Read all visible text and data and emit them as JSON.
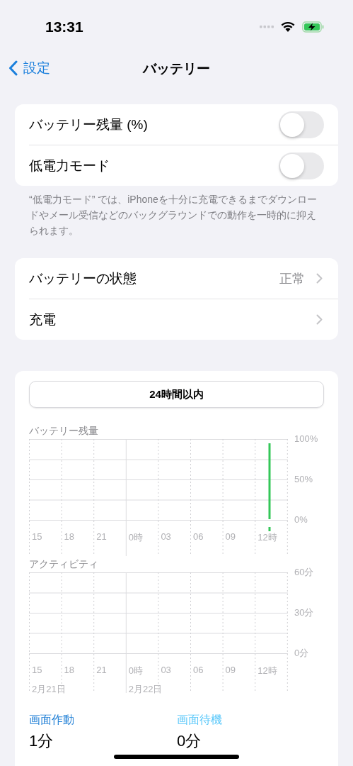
{
  "status_bar": {
    "time": "13:31"
  },
  "nav": {
    "back": "設定",
    "title": "バッテリー"
  },
  "toggles": [
    {
      "label": "バッテリー残量 (%)",
      "on": false
    },
    {
      "label": "低電力モード",
      "on": false
    }
  ],
  "footnote": "“低電力モード” では、iPhoneを十分に充電できるまでダウンロードやメール受信などのバックグラウンドでの動作を一時的に抑えられます。",
  "links": [
    {
      "label": "バッテリーの状態",
      "value": "正常"
    },
    {
      "label": "充電"
    }
  ],
  "usage": {
    "range_button": "24時間以内",
    "battery_chart": {
      "title": "バッテリー残量",
      "y_labels": [
        "100%",
        "50%",
        "0%"
      ],
      "x_labels": [
        "15",
        "18",
        "21",
        "0時",
        "03",
        "06",
        "09",
        "12時"
      ]
    },
    "activity_chart": {
      "title": "アクティビティ",
      "y_labels": [
        "60分",
        "30分",
        "0分"
      ],
      "x_labels": [
        "15",
        "18",
        "21",
        "0時",
        "03",
        "06",
        "09",
        "12時"
      ],
      "dates": [
        "2月21日",
        "2月22日"
      ]
    },
    "stats": [
      {
        "label": "画面作動",
        "value": "1分",
        "color": "#1f7fd6"
      },
      {
        "label": "画面待機",
        "value": "0分",
        "color": "#5ac8fa"
      }
    ]
  }
}
